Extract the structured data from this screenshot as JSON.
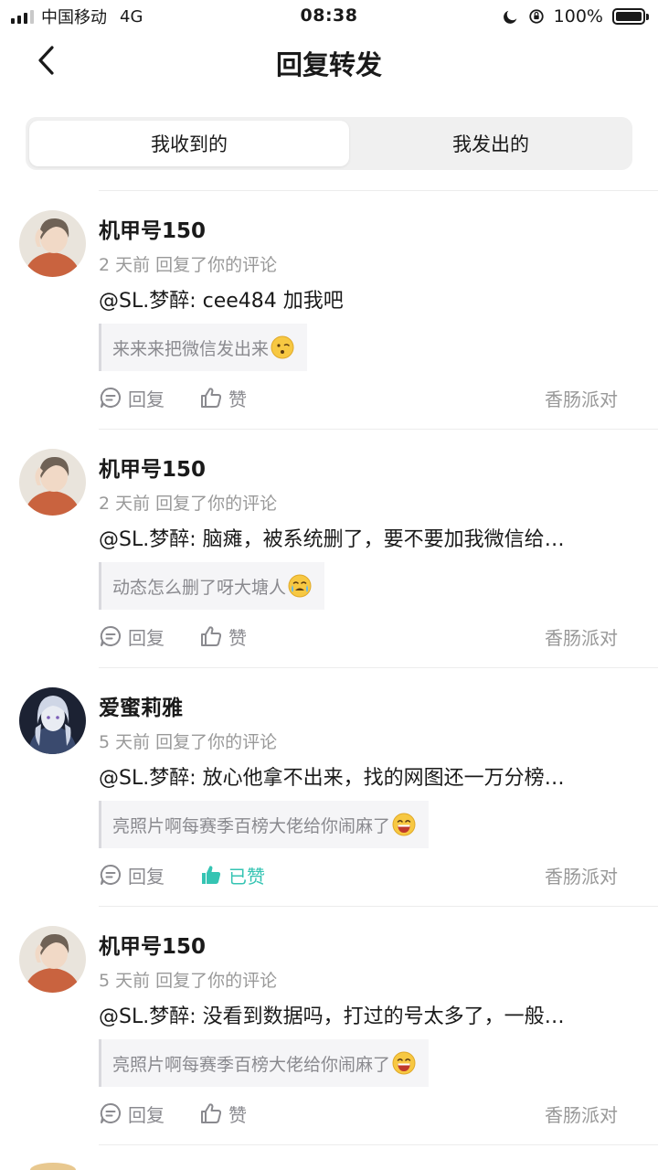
{
  "status_bar": {
    "carrier": "中国移动",
    "network": "4G",
    "time": "08:38",
    "battery": "100%"
  },
  "nav": {
    "title": "回复转发"
  },
  "tabs": [
    {
      "label": "我收到的",
      "active": true
    },
    {
      "label": "我发出的",
      "active": false
    }
  ],
  "items": [
    {
      "name": "机甲号150",
      "meta": "2 天前 回复了你的评论",
      "text": "@SL.梦醉: cee484 加我吧",
      "quote": "来来来把微信发出来",
      "quote_emoji": "smirk-emoji",
      "reply_label": "回复",
      "like_label": "赞",
      "liked": false,
      "source": "香肠派对"
    },
    {
      "name": "机甲号150",
      "meta": "2 天前 回复了你的评论",
      "text": "@SL.梦醉: 脑瘫，被系统删了，要不要加我微信给…",
      "quote": "动态怎么删了呀大塘人",
      "quote_emoji": "crying-emoji",
      "reply_label": "回复",
      "like_label": "赞",
      "liked": false,
      "source": "香肠派对"
    },
    {
      "name": "爱蜜莉雅",
      "meta": "5 天前 回复了你的评论",
      "text": "@SL.梦醉: 放心他拿不出来，找的网图还一万分榜…",
      "quote": "亮照片啊每赛季百榜大佬给你闹麻了",
      "quote_emoji": "grinning-emoji",
      "reply_label": "回复",
      "like_label": "已赞",
      "liked": true,
      "source": "香肠派对"
    },
    {
      "name": "机甲号150",
      "meta": "5 天前 回复了你的评论",
      "text": "@SL.梦醉: 没看到数据吗，打过的号太多了，一般…",
      "quote": "亮照片啊每赛季百榜大佬给你闹麻了",
      "quote_emoji": "grinning-emoji",
      "reply_label": "回复",
      "like_label": "赞",
      "liked": false,
      "source": "香肠派对"
    }
  ],
  "colors": {
    "liked": "#35c4b3",
    "muted": "#999999",
    "segment_bg": "#f0f0f0"
  }
}
